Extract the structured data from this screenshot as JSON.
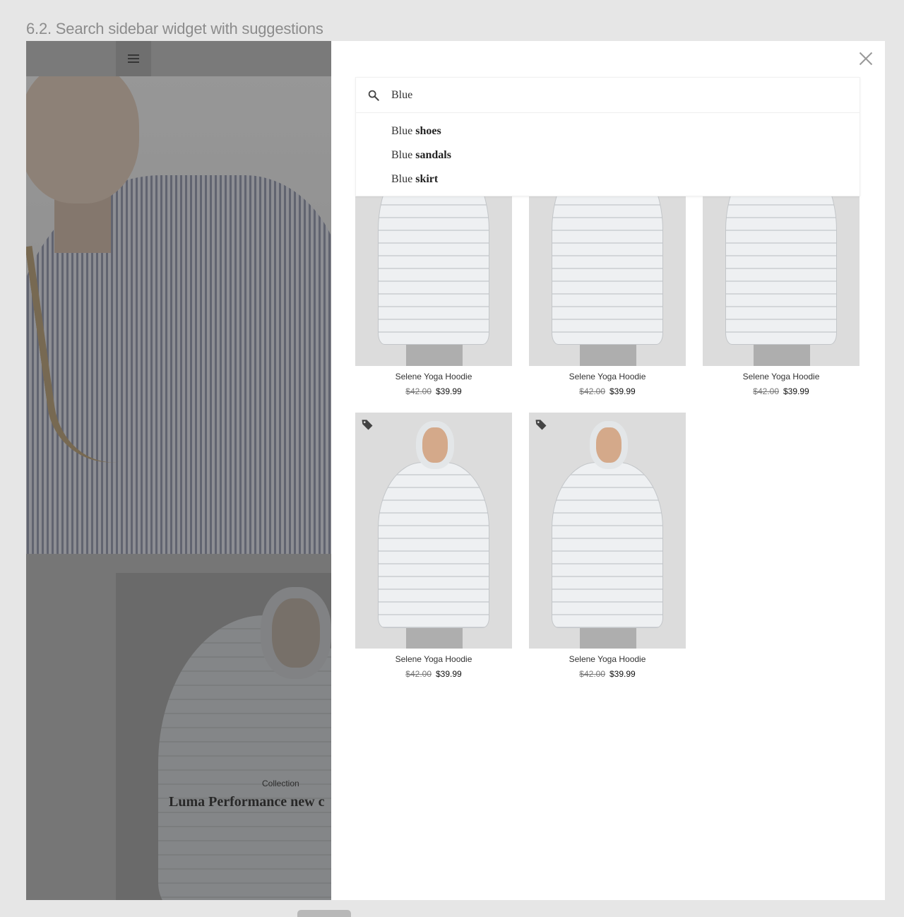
{
  "page_heading": "6.2. Search sidebar widget with suggestions",
  "site": {
    "collection_label": "Collection",
    "collection_title": "Luma Performance new c"
  },
  "search": {
    "value": "Blue",
    "suggestions": [
      {
        "prefix": "Blue ",
        "completion": "shoes"
      },
      {
        "prefix": "Blue ",
        "completion": "sandals"
      },
      {
        "prefix": "Blue ",
        "completion": "skirt"
      }
    ]
  },
  "products": [
    {
      "name": "Selene Yoga Hoodie",
      "old_price": "$42.00",
      "price": "$39.99",
      "sale_tag": false
    },
    {
      "name": "Selene Yoga Hoodie",
      "old_price": "$42.00",
      "price": "$39.99",
      "sale_tag": false
    },
    {
      "name": "Selene Yoga Hoodie",
      "old_price": "$42.00",
      "price": "$39.99",
      "sale_tag": false
    },
    {
      "name": "Selene Yoga Hoodie",
      "old_price": "$42.00",
      "price": "$39.99",
      "sale_tag": true
    },
    {
      "name": "Selene Yoga Hoodie",
      "old_price": "$42.00",
      "price": "$39.99",
      "sale_tag": true
    }
  ],
  "icons": {
    "menu": "hamburger-menu-icon",
    "close": "close-icon",
    "search": "search-icon",
    "tag": "sale-tag-icon"
  }
}
